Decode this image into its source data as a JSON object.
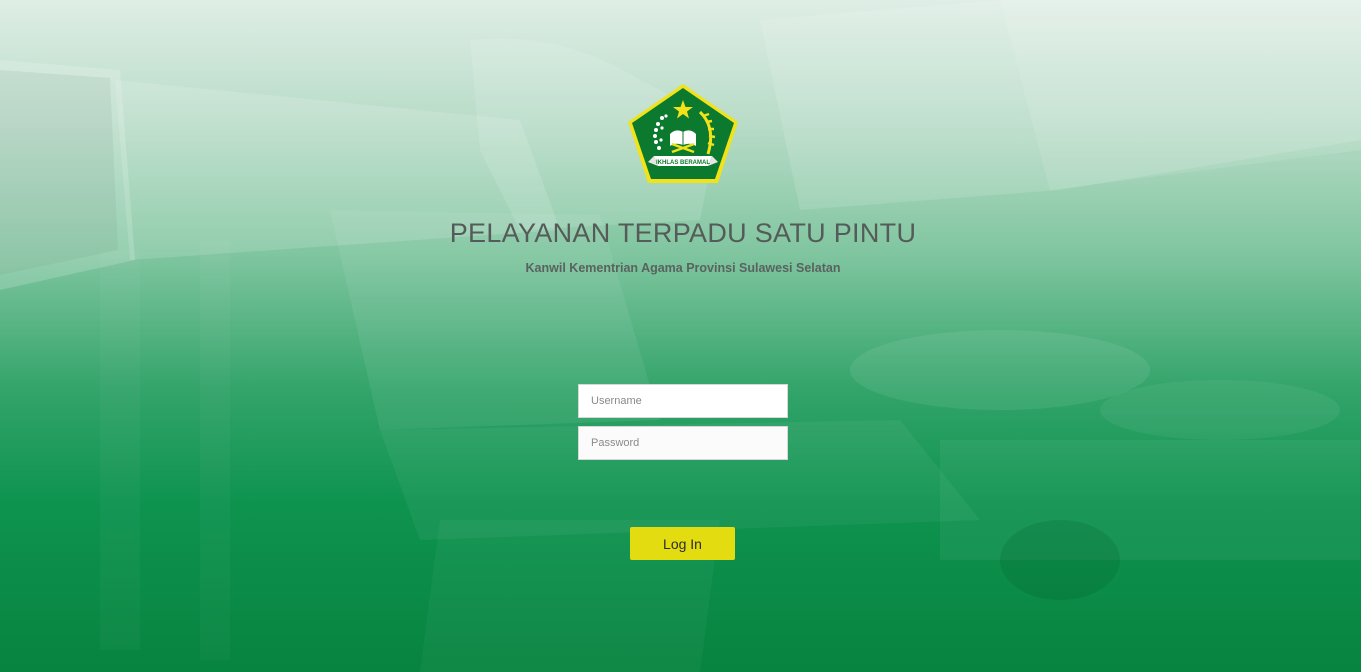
{
  "header": {
    "title": "PELAYANAN TERPADU SATU PINTU",
    "subtitle": "Kanwil Kementrian Agama Provinsi Sulawesi Selatan"
  },
  "logo": {
    "motto": "IKHLAS BERAMAL",
    "icon": "kemenag-emblem-icon"
  },
  "form": {
    "username_placeholder": "Username",
    "username_value": "",
    "password_placeholder": "Password",
    "password_value": "",
    "login_label": "Log In"
  },
  "colors": {
    "background_top": "#dfeee6",
    "background_bottom": "#07843f",
    "button": "#e3dc11",
    "emblem_green": "#0b7a2e",
    "emblem_gold": "#f1e21a"
  }
}
